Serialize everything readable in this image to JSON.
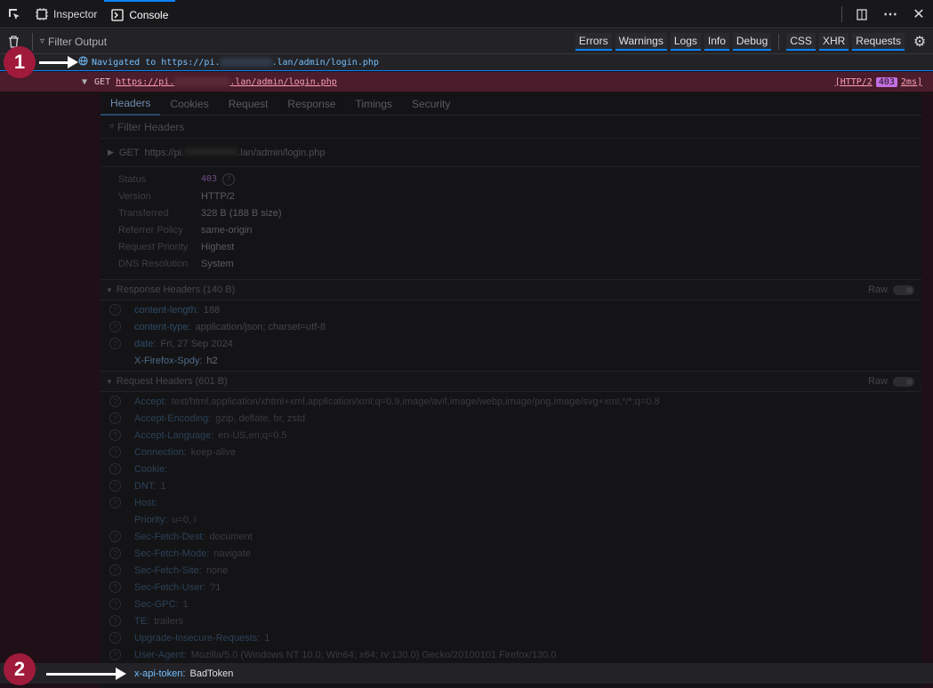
{
  "toolbar": {
    "tabs": [
      {
        "label": "Inspector"
      },
      {
        "label": "Console"
      }
    ]
  },
  "filter": {
    "placeholder": "Filter Output",
    "buttons": [
      "Errors",
      "Warnings",
      "Logs",
      "Info",
      "Debug",
      "CSS",
      "XHR",
      "Requests"
    ]
  },
  "console": {
    "nav_prefix": "Navigated to https://pi.",
    "nav_suffix": ".lan/admin/login.php",
    "req_method": "GET",
    "req_url_prefix": "https://pi.",
    "req_url_suffix": ".lan/admin/login.php",
    "req_proto": "[HTTP/2",
    "req_status": "403",
    "req_time": "2ms]"
  },
  "panel": {
    "subtabs": [
      "Headers",
      "Cookies",
      "Request",
      "Response",
      "Timings",
      "Security"
    ],
    "filter_headers": "Filter Headers",
    "summary_method": "GET",
    "summary_prefix": "https://pi.",
    "summary_suffix": ".lan/admin/login.php",
    "info": [
      {
        "k": "Status",
        "v": "403"
      },
      {
        "k": "Version",
        "v": "HTTP/2"
      },
      {
        "k": "Transferred",
        "v": "328 B (188 B size)"
      },
      {
        "k": "Referrer Policy",
        "v": "same-origin"
      },
      {
        "k": "Request Priority",
        "v": "Highest"
      },
      {
        "k": "DNS Resolution",
        "v": "System"
      }
    ],
    "response_section": "Response Headers (140 B)",
    "raw_label": "Raw",
    "response_headers": [
      {
        "k": "content-length:",
        "v": "188"
      },
      {
        "k": "content-type:",
        "v": "application/json; charset=utf-8"
      },
      {
        "k": "date:",
        "v": "Fri, 27 Sep 2024"
      },
      {
        "k": "X-Firefox-Spdy:",
        "v": "h2"
      }
    ],
    "request_section": "Request Headers (601 B)",
    "request_headers": [
      {
        "k": "Accept:",
        "v": "text/html,application/xhtml+xml,application/xml;q=0.9,image/avif,image/webp,image/png,image/svg+xml,*/*;q=0.8"
      },
      {
        "k": "Accept-Encoding:",
        "v": "gzip, deflate, br, zstd"
      },
      {
        "k": "Accept-Language:",
        "v": "en-US,en;q=0.5"
      },
      {
        "k": "Connection:",
        "v": "keep-alive"
      },
      {
        "k": "Cookie:",
        "v": ""
      },
      {
        "k": "DNT:",
        "v": "1"
      },
      {
        "k": "Host:",
        "v": ""
      },
      {
        "k": "Priority:",
        "v": "u=0, i"
      },
      {
        "k": "Sec-Fetch-Dest:",
        "v": "document"
      },
      {
        "k": "Sec-Fetch-Mode:",
        "v": "navigate"
      },
      {
        "k": "Sec-Fetch-Site:",
        "v": "none"
      },
      {
        "k": "Sec-Fetch-User:",
        "v": "?1"
      },
      {
        "k": "Sec-GPC:",
        "v": "1"
      },
      {
        "k": "TE:",
        "v": "trailers"
      },
      {
        "k": "Upgrade-Insecure-Requests:",
        "v": "1"
      },
      {
        "k": "User-Agent:",
        "v": "Mozilla/5.0 (Windows NT 10.0; Win64; x64; rv:130.0) Gecko/20100101 Firefox/130.0"
      }
    ],
    "token_key": "x-api-token:",
    "token_value": "BadToken"
  },
  "markers": [
    "1",
    "2"
  ],
  "colors": {
    "accent": "#0a84ff",
    "marker": "#a01a3c",
    "error_row": "#4b1c2b"
  }
}
